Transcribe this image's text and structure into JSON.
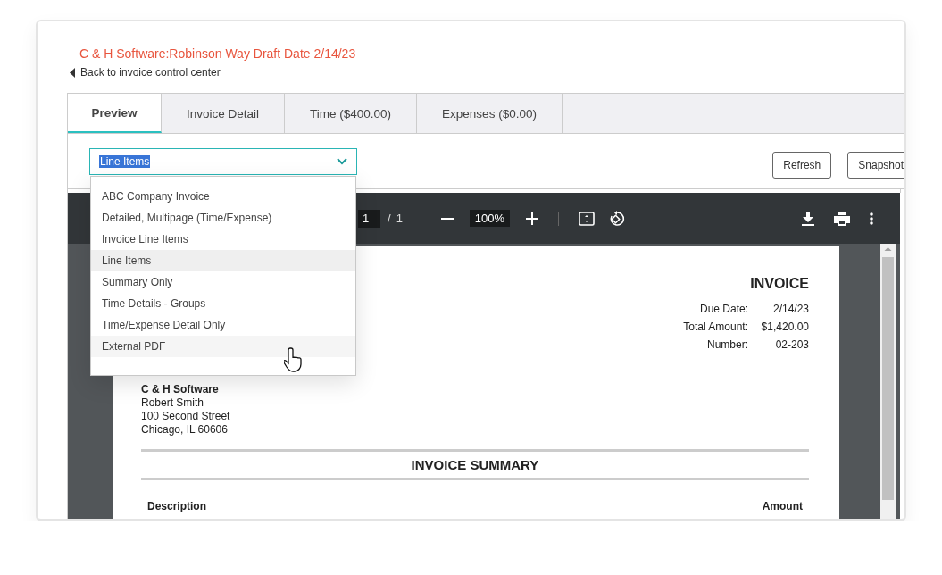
{
  "header": {
    "title": "C & H Software:Robinson Way Draft Date 2/14/23",
    "back_link": "Back to invoice control center"
  },
  "tabs": [
    {
      "label": "Preview",
      "selected": true
    },
    {
      "label": "Invoice Detail",
      "selected": false
    },
    {
      "label": "Time ($400.00)",
      "selected": false
    },
    {
      "label": "Expenses ($0.00)",
      "selected": false
    }
  ],
  "template_select": {
    "value": "Line Items",
    "expanded": true,
    "options": [
      {
        "label": "ABC Company Invoice",
        "selected": false,
        "hovered": false
      },
      {
        "label": "Detailed, Multipage (Time/Expense)",
        "selected": false,
        "hovered": false
      },
      {
        "label": "Invoice Line Items",
        "selected": false,
        "hovered": false
      },
      {
        "label": "Line Items",
        "selected": true,
        "hovered": false
      },
      {
        "label": "Summary Only",
        "selected": false,
        "hovered": false
      },
      {
        "label": "Time Details - Groups",
        "selected": false,
        "hovered": false
      },
      {
        "label": "Time/Expense Detail Only",
        "selected": false,
        "hovered": false
      },
      {
        "label": "External PDF",
        "selected": false,
        "hovered": true
      }
    ]
  },
  "buttons": [
    "Refresh",
    "Snapshot"
  ],
  "pdf_toolbar": {
    "page": "1",
    "separator": "/",
    "page_count": "1",
    "zoom": "100%"
  },
  "document": {
    "title": "INVOICE",
    "fields": [
      {
        "label": "Due Date:",
        "value": "2/14/23"
      },
      {
        "label": "Total Amount:",
        "value": "$1,420.00"
      },
      {
        "label": "Number:",
        "value": "02-203"
      }
    ],
    "company": "C & H Software",
    "address": [
      "Robert Smith",
      "100 Second Street",
      "Chicago, IL 60606"
    ],
    "section_title": "INVOICE SUMMARY",
    "columns": [
      "Description",
      "Amount"
    ]
  }
}
